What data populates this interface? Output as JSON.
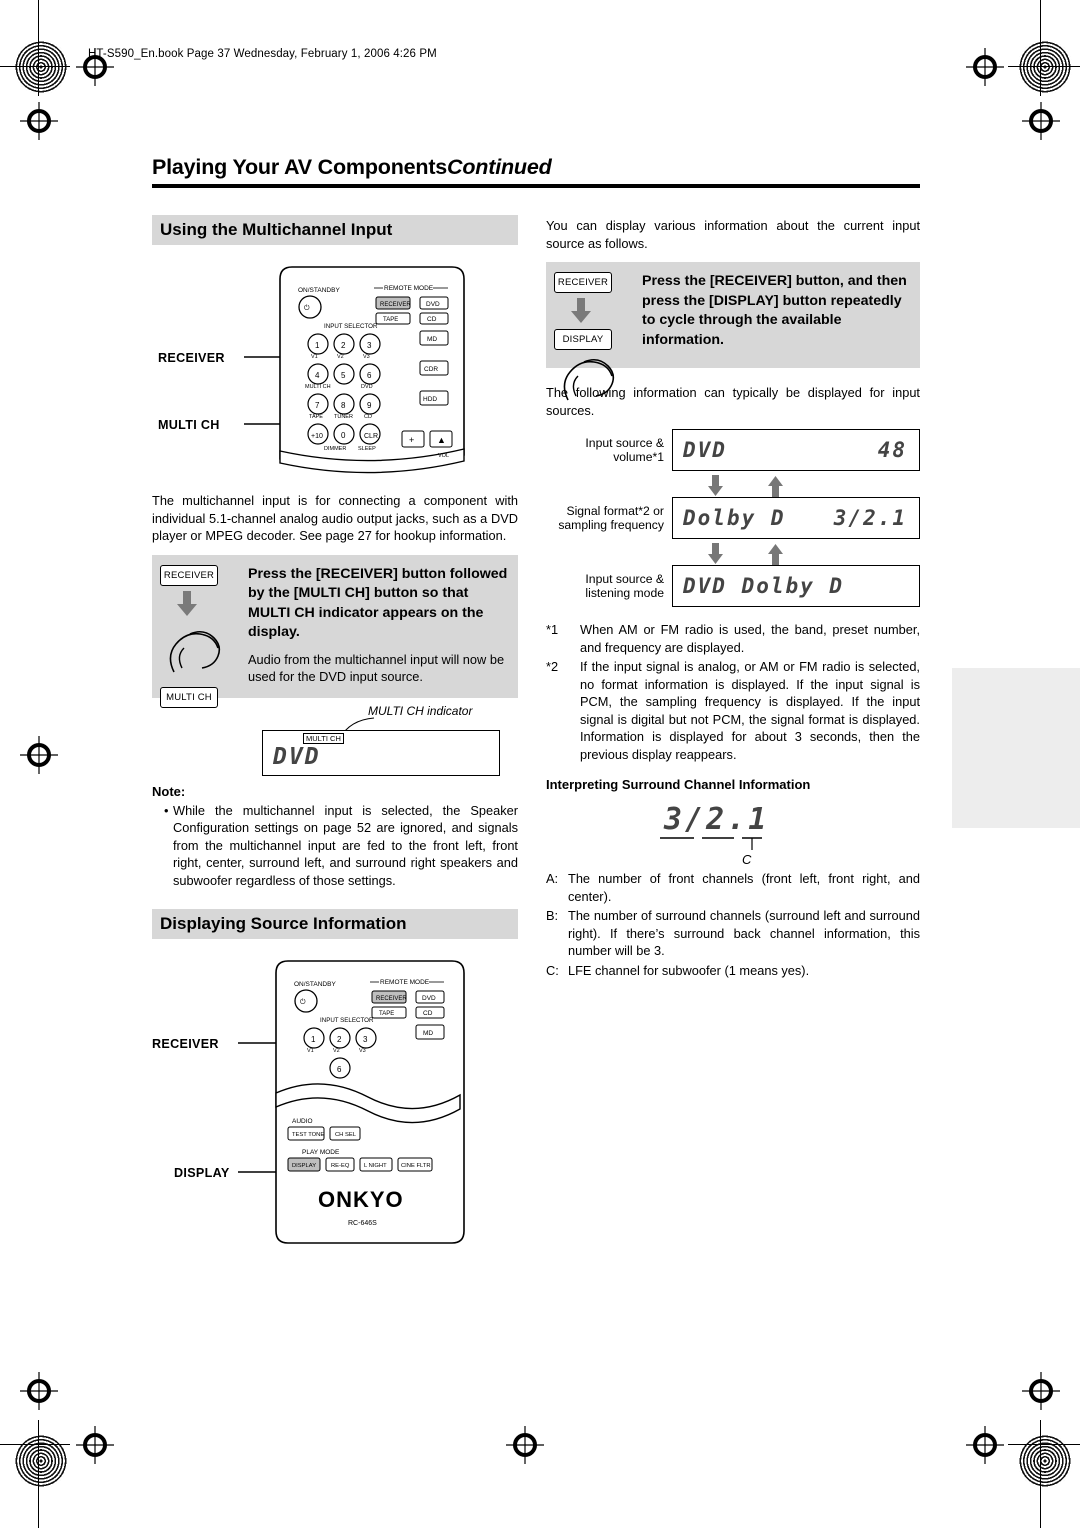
{
  "header_line": "HT-S590_En.book  Page 37  Wednesday, February 1, 2006  4:26 PM",
  "page_title": {
    "main": "Playing Your AV Components",
    "continued": "Continued"
  },
  "left": {
    "section1_title": "Using the Multichannel Input",
    "remote1": {
      "label_receiver": "RECEIVER",
      "label_multich": "MULTI CH",
      "onstandby": "ON/STANDBY",
      "remote_mode": "REMOTE MODE",
      "input_selector": "INPUT SELECTOR",
      "keys": [
        "1",
        "2",
        "3",
        "4",
        "5",
        "6",
        "7",
        "8",
        "9",
        "+10",
        "0",
        "CLR"
      ],
      "keysub": [
        "V1",
        "V2",
        "V3",
        "MULTI CH",
        "DVD",
        "TAPE",
        "TUNER",
        "CD"
      ],
      "side": [
        "RECEIVER",
        "DVD",
        "TAPE",
        "CD",
        "MD",
        "CDR",
        "HDD"
      ],
      "bottom": [
        "DIMMER",
        "SLEEP"
      ],
      "vol": [
        "+",
        "▲",
        "VOL"
      ]
    },
    "para1": "The multichannel input is for connecting a component with individual 5.1-channel analog audio output jacks, such as a DVD player or MPEG decoder. See page 27 for hookup information.",
    "instruction1": {
      "btn_top": "RECEIVER",
      "btn_bottom": "MULTI CH",
      "bold": "Press the [RECEIVER] button followed by the [MULTI CH] button so that MULTI CH indicator appears on the display.",
      "sub": "Audio from the multichannel input will now be used for the DVD input source."
    },
    "lcd1": {
      "caption": "MULTI CH indicator",
      "indicator": "MULTI CH",
      "text": "DVD"
    },
    "note_head": "Note:",
    "note_items": [
      "While the multichannel input is selected, the Speaker Configuration settings on page 52 are ignored, and signals from the multichannel input are fed to the front left, front right, center, surround left, and surround right speakers and subwoofer regardless of those settings."
    ],
    "section2_title": "Displaying Source Information",
    "remote2": {
      "label_receiver": "RECEIVER",
      "label_display": "DISPLAY",
      "onstandby": "ON/STANDBY",
      "remote_mode": "REMOTE MODE",
      "input_selector": "INPUT SELECTOR",
      "keys": [
        "1",
        "2",
        "3",
        "6"
      ],
      "keysub": [
        "V1",
        "V2",
        "V3"
      ],
      "side": [
        "RECEIVER",
        "DVD",
        "TAPE",
        "CD",
        "MD"
      ],
      "audio_label": "AUDIO",
      "audio_keys": [
        "TEST TONE",
        "CH SEL"
      ],
      "playmode_label": "PLAY MODE",
      "playmode_keys": [
        "DISPLAY",
        "RE-EQ",
        "L NIGHT",
        "CINE FLTR"
      ],
      "brand": "ONKYO",
      "model": "RC-646S"
    }
  },
  "right": {
    "intro": "You can display various information about the current input source as follows.",
    "instruction2": {
      "btn_top": "RECEIVER",
      "btn_bottom": "DISPLAY",
      "bold": "Press the [RECEIVER] button, and then press the [DISPLAY] button repeatedly to cycle through the available information."
    },
    "para_following": "The following information can typically be displayed for input sources.",
    "cycle_rows": [
      {
        "label": "Input source & volume*1",
        "left": "DVD",
        "right": "48"
      },
      {
        "label": "Signal format*2 or sampling frequency",
        "left": "Dolby D",
        "right": "3/2.1"
      },
      {
        "label": "Input source & listening mode",
        "left": "DVD  Dolby D",
        "right": ""
      }
    ],
    "footnotes": [
      {
        "n": "*1",
        "t": "When AM or FM radio is used, the band, preset number, and frequency are displayed."
      },
      {
        "n": "*2",
        "t": "If the input signal is analog, or AM or FM radio is selected, no format information is displayed. If the input signal is PCM, the sampling frequency is displayed. If the input signal is digital but not PCM, the signal format is displayed. Information is displayed for about 3 seconds, then the previous display reappears."
      }
    ],
    "interpret_head": "Interpreting Surround Channel Information",
    "interpret_display": {
      "text": "3/2.1",
      "mark_c": "C"
    },
    "abc": [
      {
        "k": "A:",
        "v": "The number of front channels (front left, front right, and center)."
      },
      {
        "k": "B:",
        "v": "The number of surround channels (surround left and surround right). If there’s surround back channel information, this number will be 3."
      },
      {
        "k": "C:",
        "v": "LFE channel for subwoofer (1 means yes)."
      }
    ]
  }
}
